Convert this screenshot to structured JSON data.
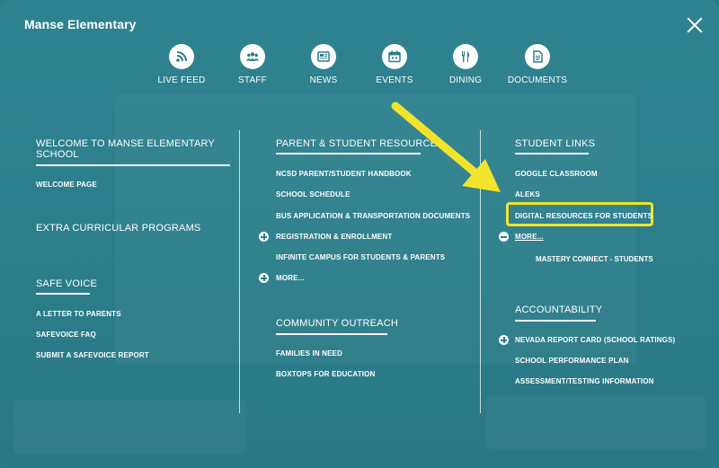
{
  "site": {
    "title": "Manse Elementary"
  },
  "quick_links": [
    {
      "label": "LIVE FEED",
      "icon": "rss-icon"
    },
    {
      "label": "STAFF",
      "icon": "people-icon"
    },
    {
      "label": "NEWS",
      "icon": "newspaper-icon"
    },
    {
      "label": "EVENTS",
      "icon": "calendar-icon"
    },
    {
      "label": "DINING",
      "icon": "fork-knife-icon"
    },
    {
      "label": "DOCUMENTS",
      "icon": "document-icon"
    }
  ],
  "col1": {
    "welcome_heading": "WELCOME TO MANSE ELEMENTARY SCHOOL",
    "welcome_links": [
      "WELCOME PAGE"
    ],
    "extracurricular_heading": "EXTRA CURRICULAR PROGRAMS",
    "safevoice_heading": "SAFE VOICE",
    "safevoice_links": [
      "A LETTER TO PARENTS",
      "SAFEVOICE FAQ",
      "SUBMIT A SAFEVOICE REPORT"
    ]
  },
  "col2": {
    "resources_heading": "PARENT & STUDENT RESOURCES",
    "resources_links": [
      "NCSD PARENT/STUDENT HANDBOOK",
      "SCHOOL SCHEDULE",
      "BUS APPLICATION & TRANSPORTATION DOCUMENTS",
      "REGISTRATION & ENROLLMENT",
      "INFINITE CAMPUS FOR STUDENTS & PARENTS",
      "MORE..."
    ],
    "community_heading": "COMMUNITY OUTREACH",
    "community_links": [
      "FAMILIES IN NEED",
      "BOXTOPS FOR EDUCATION"
    ]
  },
  "col3": {
    "student_heading": "STUDENT LINKS",
    "student_links": [
      "GOOGLE CLASSROOM",
      "ALEKS",
      "DIGITAL RESOURCES FOR STUDENTS",
      "MORE..."
    ],
    "student_sublinks": [
      "MASTERY CONNECT - STUDENTS"
    ],
    "accountability_heading": "ACCOUNTABILITY",
    "accountability_links": [
      "NEVADA REPORT CARD (SCHOOL RATINGS)",
      "SCHOOL PERFORMANCE PLAN",
      "ASSESSMENT/TESTING INFORMATION"
    ]
  },
  "colors": {
    "background": "#2b7d8a",
    "highlight": "#f1e42a",
    "text": "#ffffff"
  }
}
